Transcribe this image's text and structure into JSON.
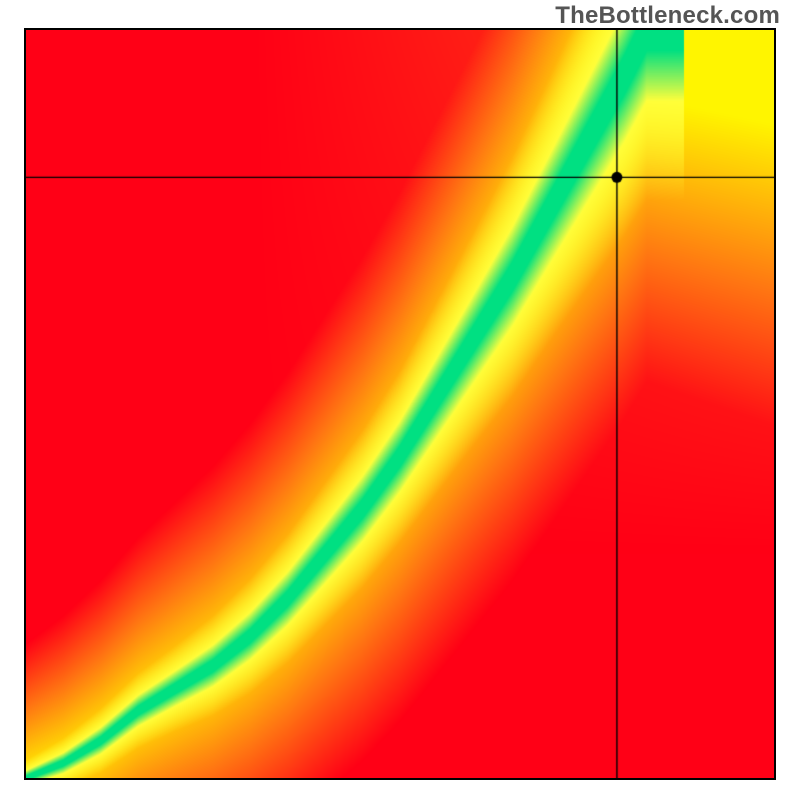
{
  "watermark": "TheBottleneck.com",
  "chart_data": {
    "type": "heatmap",
    "title": "",
    "xlabel": "",
    "ylabel": "",
    "xlim": [
      0,
      1
    ],
    "ylim": [
      0,
      1
    ],
    "marker": {
      "x": 0.79,
      "y": 0.803
    },
    "crosshair": {
      "x": 0.79,
      "y": 0.803
    },
    "ridge": {
      "points": [
        [
          0.0,
          0.0
        ],
        [
          0.05,
          0.02
        ],
        [
          0.1,
          0.05
        ],
        [
          0.15,
          0.09
        ],
        [
          0.2,
          0.12
        ],
        [
          0.25,
          0.15
        ],
        [
          0.3,
          0.19
        ],
        [
          0.35,
          0.24
        ],
        [
          0.4,
          0.3
        ],
        [
          0.45,
          0.36
        ],
        [
          0.5,
          0.43
        ],
        [
          0.55,
          0.51
        ],
        [
          0.6,
          0.59
        ],
        [
          0.65,
          0.67
        ],
        [
          0.7,
          0.76
        ],
        [
          0.75,
          0.85
        ],
        [
          0.8,
          0.94
        ],
        [
          0.83,
          1.0
        ]
      ],
      "width": [
        [
          0.0,
          0.01
        ],
        [
          0.1,
          0.018
        ],
        [
          0.2,
          0.024
        ],
        [
          0.3,
          0.032
        ],
        [
          0.4,
          0.04
        ],
        [
          0.5,
          0.048
        ],
        [
          0.6,
          0.06
        ],
        [
          0.7,
          0.074
        ],
        [
          0.8,
          0.09
        ],
        [
          0.83,
          0.095
        ]
      ]
    },
    "background": {
      "corner_top_left": "#ff0016",
      "corner_top_right": "#fff500",
      "corner_bottom_left": "#ff0016",
      "corner_bottom_right": "#ff0016",
      "ridge_color": "#00e082",
      "halo_color": "#ffff3c"
    }
  }
}
